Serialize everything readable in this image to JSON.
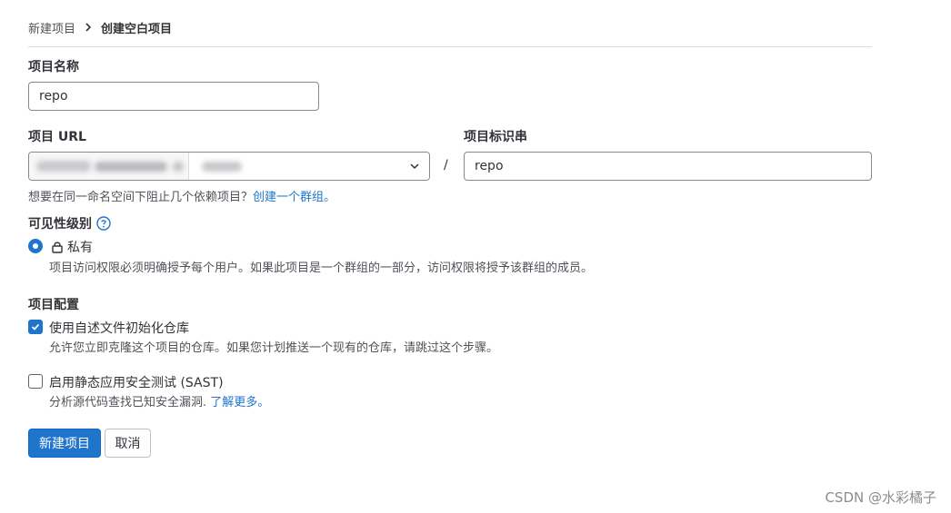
{
  "breadcrumb": {
    "parent": "新建项目",
    "current": "创建空白项目"
  },
  "project_name": {
    "label": "项目名称",
    "value": "repo"
  },
  "project_url": {
    "label": "项目 URL",
    "separator": "/"
  },
  "project_slug": {
    "label": "项目标识串",
    "value": "repo"
  },
  "group_hint": {
    "text": "想要在同一命名空间下阻止几个依赖项目？",
    "link": "创建一个群组。"
  },
  "visibility": {
    "label": "可见性级别",
    "option_label": "私有",
    "option_description": "项目访问权限必须明确授予每个用户。如果此项目是一个群组的一部分，访问权限将授予该群组的成员。"
  },
  "config": {
    "label": "项目配置",
    "readme": {
      "label": "使用自述文件初始化仓库",
      "description": "允许您立即克隆这个项目的仓库。如果您计划推送一个现有的仓库，请跳过这个步骤。",
      "checked": true
    },
    "sast": {
      "label": "启用静态应用安全测试 (SAST)",
      "description": "分析源代码查找已知安全漏洞.",
      "link": "了解更多。",
      "checked": false
    }
  },
  "actions": {
    "create": "新建项目",
    "cancel": "取消"
  },
  "watermark": "CSDN @水彩橘子",
  "icons": [
    "chevron-right-icon",
    "chevron-down-icon",
    "question-circle-icon",
    "lock-icon",
    "check-icon"
  ],
  "colors": {
    "accent": "#1f75cb",
    "text": "#333238",
    "border": "#89888d"
  }
}
